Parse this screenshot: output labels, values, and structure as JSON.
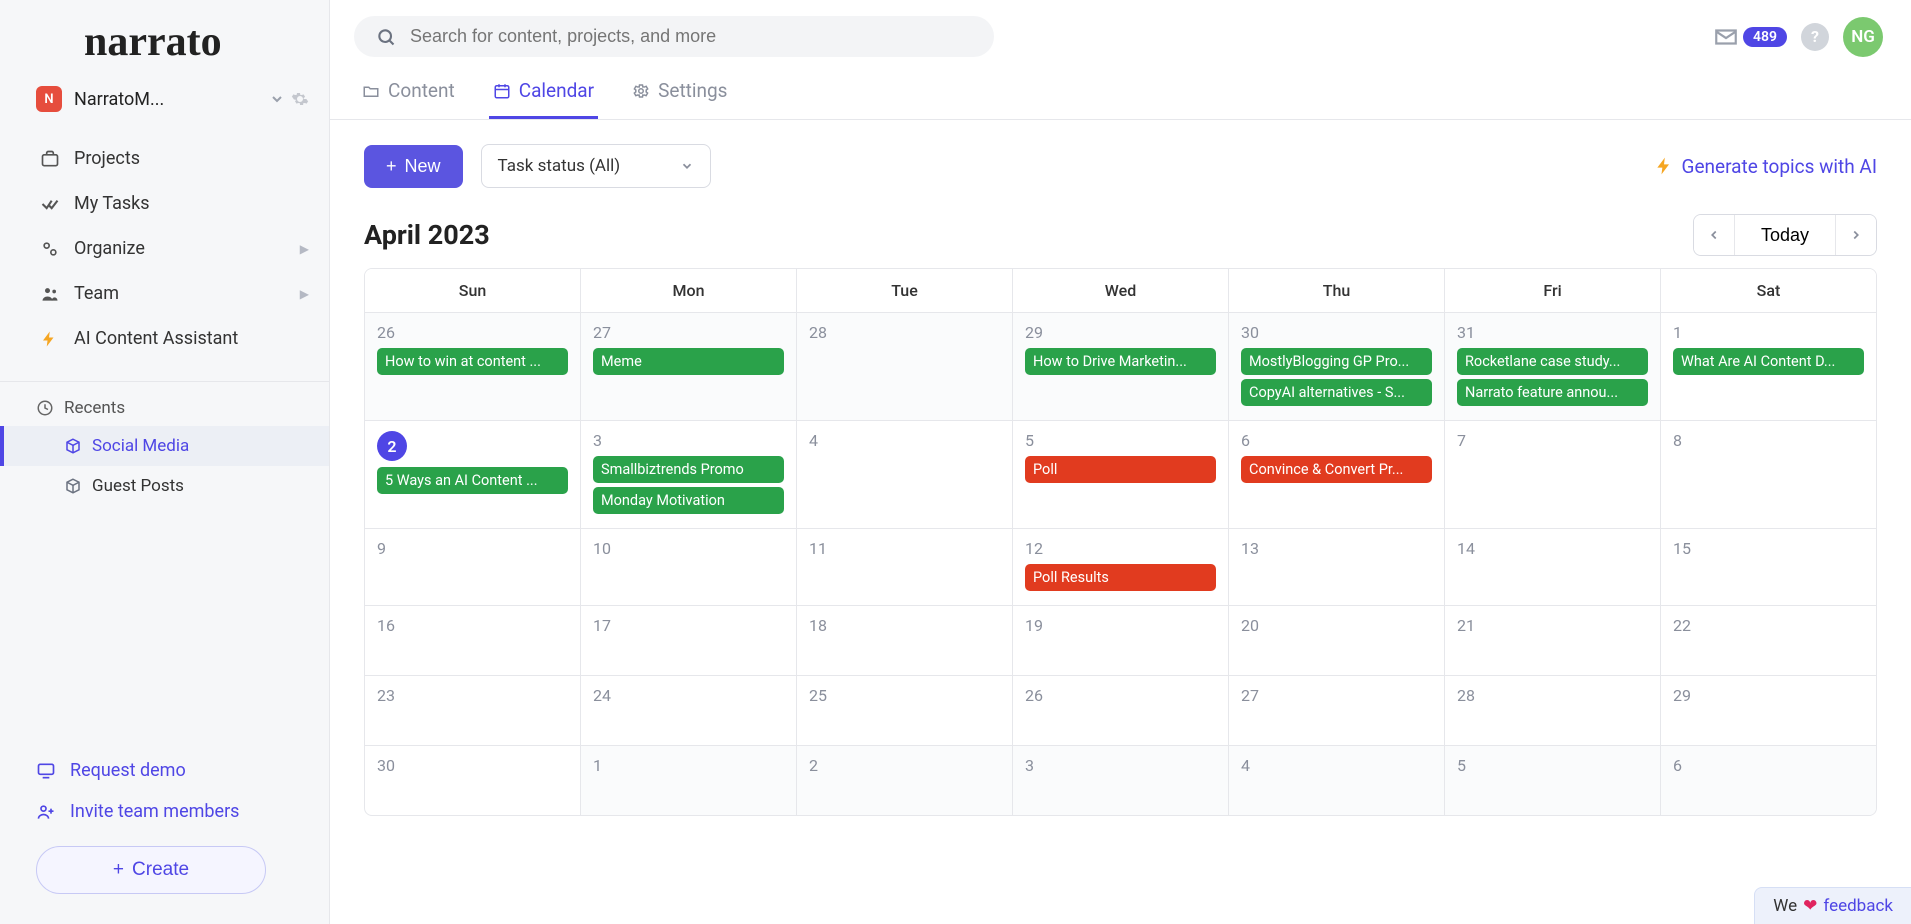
{
  "brand": "narrato",
  "workspace": {
    "badge": "N",
    "name": "NarratoM..."
  },
  "search": {
    "placeholder": "Search for content, projects, and more"
  },
  "notifications": {
    "count": "489"
  },
  "user": {
    "initials": "NG"
  },
  "sidebar": {
    "projects": "Projects",
    "myTasks": "My Tasks",
    "organize": "Organize",
    "team": "Team",
    "aiAssistant": "AI Content Assistant",
    "recentsHeader": "Recents",
    "recents": [
      {
        "label": "Social Media"
      },
      {
        "label": "Guest Posts"
      }
    ],
    "requestDemo": "Request demo",
    "inviteTeam": "Invite team members",
    "create": "Create"
  },
  "tabs": {
    "content": "Content",
    "calendar": "Calendar",
    "settings": "Settings"
  },
  "toolbar": {
    "newLabel": "New",
    "filterLabel": "Task status (All)",
    "generateLabel": "Generate topics with AI"
  },
  "calendar": {
    "title": "April 2023",
    "today": "Today",
    "dayHeaders": [
      "Sun",
      "Mon",
      "Tue",
      "Wed",
      "Thu",
      "Fri",
      "Sat"
    ],
    "weeks": [
      [
        {
          "num": "26",
          "out": true,
          "events": [
            {
              "text": "How to win at content ...",
              "color": "green"
            }
          ]
        },
        {
          "num": "27",
          "out": true,
          "events": [
            {
              "text": "Meme",
              "color": "green"
            }
          ]
        },
        {
          "num": "28",
          "out": true,
          "events": []
        },
        {
          "num": "29",
          "out": true,
          "events": [
            {
              "text": "How to Drive Marketin...",
              "color": "green"
            }
          ]
        },
        {
          "num": "30",
          "out": true,
          "events": [
            {
              "text": "MostlyBlogging GP Pro...",
              "color": "green"
            },
            {
              "text": "CopyAI alternatives - S...",
              "color": "green"
            }
          ]
        },
        {
          "num": "31",
          "out": true,
          "events": [
            {
              "text": "Rocketlane case study...",
              "color": "green"
            },
            {
              "text": "Narrato feature annou...",
              "color": "green"
            }
          ]
        },
        {
          "num": "1",
          "events": [
            {
              "text": "What Are AI Content D...",
              "color": "green"
            }
          ]
        }
      ],
      [
        {
          "num": "2",
          "today": true,
          "events": [
            {
              "text": "5 Ways an AI Content ...",
              "color": "green"
            }
          ]
        },
        {
          "num": "3",
          "events": [
            {
              "text": "Smallbiztrends Promo",
              "color": "green"
            },
            {
              "text": "Monday Motivation",
              "color": "green"
            }
          ]
        },
        {
          "num": "4",
          "events": []
        },
        {
          "num": "5",
          "events": [
            {
              "text": "Poll",
              "color": "red"
            }
          ]
        },
        {
          "num": "6",
          "events": [
            {
              "text": "Convince & Convert Pr...",
              "color": "red"
            }
          ]
        },
        {
          "num": "7",
          "events": []
        },
        {
          "num": "8",
          "events": []
        }
      ],
      [
        {
          "num": "9",
          "events": []
        },
        {
          "num": "10",
          "events": []
        },
        {
          "num": "11",
          "events": []
        },
        {
          "num": "12",
          "events": [
            {
              "text": "Poll Results",
              "color": "red"
            }
          ]
        },
        {
          "num": "13",
          "events": []
        },
        {
          "num": "14",
          "events": []
        },
        {
          "num": "15",
          "events": []
        }
      ],
      [
        {
          "num": "16",
          "events": []
        },
        {
          "num": "17",
          "events": []
        },
        {
          "num": "18",
          "events": []
        },
        {
          "num": "19",
          "events": []
        },
        {
          "num": "20",
          "events": []
        },
        {
          "num": "21",
          "events": []
        },
        {
          "num": "22",
          "events": []
        }
      ],
      [
        {
          "num": "23",
          "events": []
        },
        {
          "num": "24",
          "events": []
        },
        {
          "num": "25",
          "events": []
        },
        {
          "num": "26",
          "events": []
        },
        {
          "num": "27",
          "events": []
        },
        {
          "num": "28",
          "events": []
        },
        {
          "num": "29",
          "events": []
        }
      ],
      [
        {
          "num": "30",
          "events": []
        },
        {
          "num": "1",
          "out": true,
          "events": []
        },
        {
          "num": "2",
          "out": true,
          "events": []
        },
        {
          "num": "3",
          "out": true,
          "events": []
        },
        {
          "num": "4",
          "out": true,
          "events": []
        },
        {
          "num": "5",
          "out": true,
          "events": []
        },
        {
          "num": "6",
          "out": true,
          "events": []
        }
      ]
    ]
  },
  "feedback": {
    "we": "We",
    "label": "feedback"
  }
}
